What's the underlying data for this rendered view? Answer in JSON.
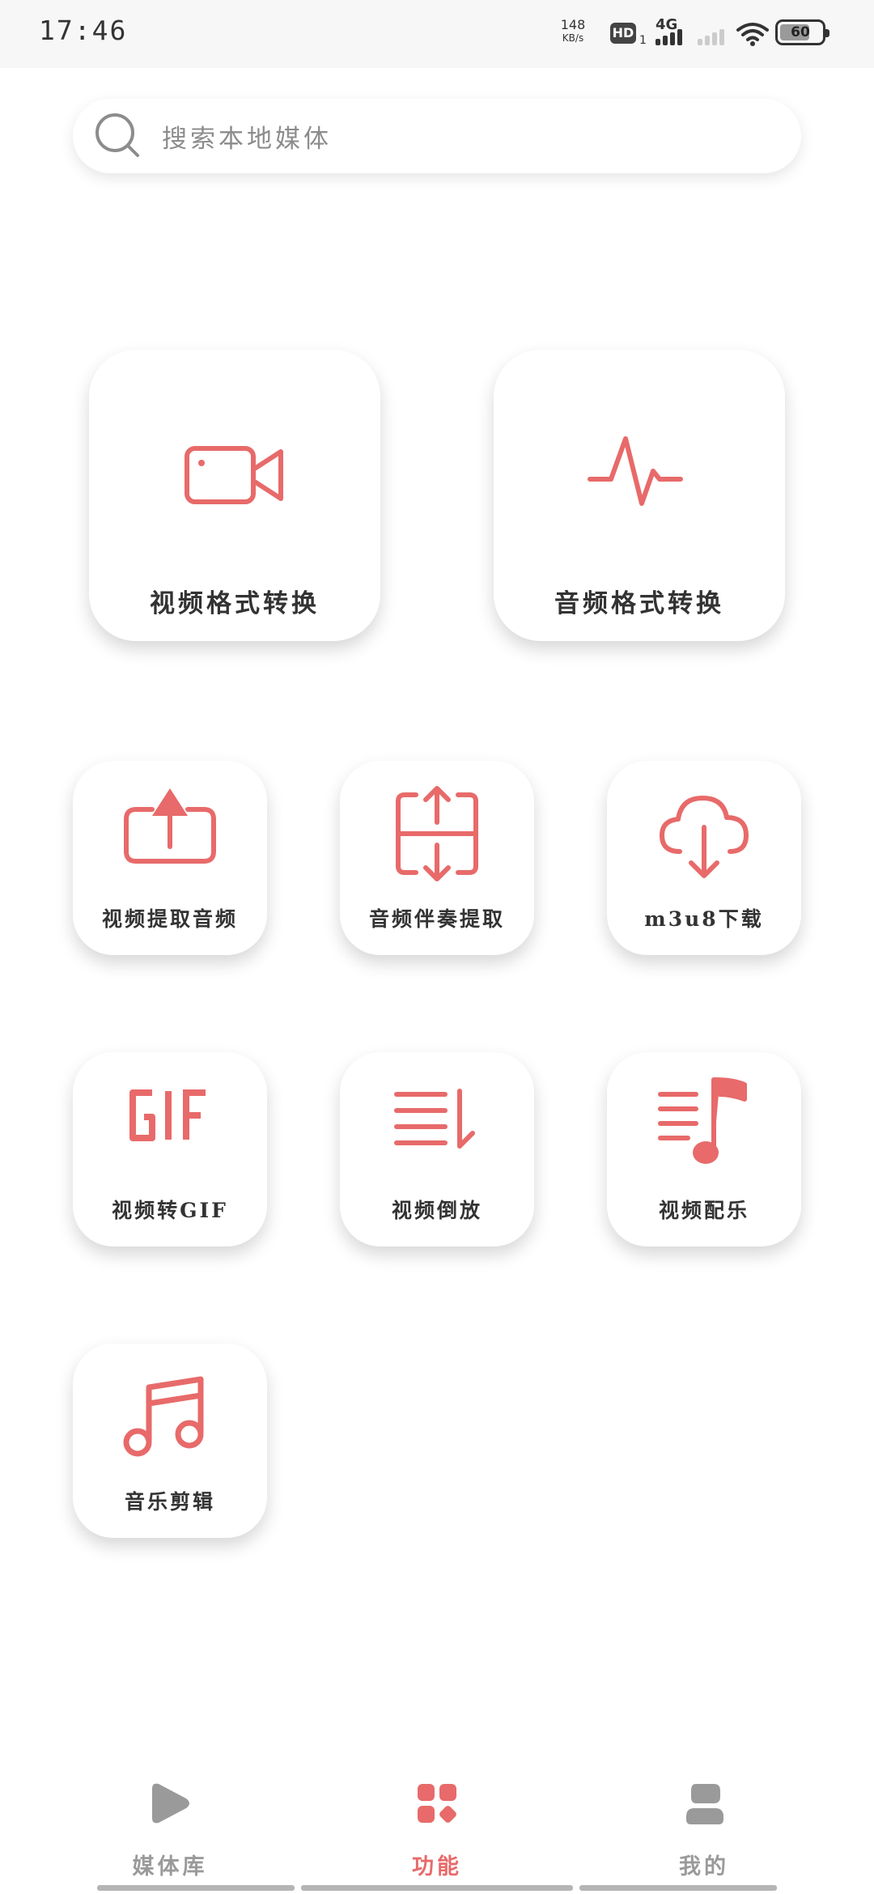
{
  "status_bar": {
    "time": "17:46",
    "net_speed_value": "148",
    "net_speed_unit": "KB/s",
    "hd_label": "HD",
    "hd_sub": "1",
    "network_type": "4G",
    "battery": "60"
  },
  "search": {
    "placeholder": "搜索本地媒体"
  },
  "features": {
    "large": [
      {
        "label": "视频格式转换",
        "icon": "video-camera-icon"
      },
      {
        "label": "音频格式转换",
        "icon": "audio-wave-icon"
      }
    ],
    "row1": [
      {
        "label": "视频提取音频",
        "icon": "upload-icon"
      },
      {
        "label": "音频伴奏提取",
        "icon": "split-arrows-icon"
      },
      {
        "label": "m3u8下载",
        "icon": "cloud-download-icon"
      }
    ],
    "row2": [
      {
        "label": "视频转GIF",
        "icon": "gif-icon"
      },
      {
        "label": "视频倒放",
        "icon": "reverse-list-icon"
      },
      {
        "label": "视频配乐",
        "icon": "music-list-icon"
      }
    ],
    "row3": [
      {
        "label": "音乐剪辑",
        "icon": "music-note-icon"
      }
    ]
  },
  "bottom_nav": {
    "items": [
      {
        "label": "媒体库",
        "icon": "play-icon",
        "active": false
      },
      {
        "label": "功能",
        "icon": "grid-icon",
        "active": true
      },
      {
        "label": "我的",
        "icon": "user-icon",
        "active": false
      }
    ]
  },
  "colors": {
    "accent": "#e86a6a",
    "inactive": "#9a9a9a",
    "text": "#333333"
  }
}
